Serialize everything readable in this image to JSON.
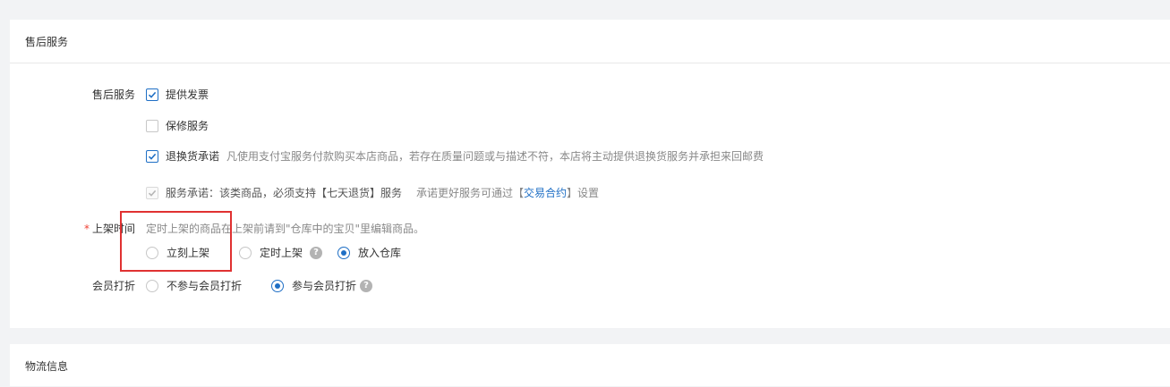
{
  "after_sales_section": {
    "title": "售后服务",
    "service_label": "售后服务",
    "options": [
      {
        "label": "提供发票",
        "checked": true
      },
      {
        "label": "保修服务",
        "checked": false
      },
      {
        "label": "退换货承诺",
        "checked": true,
        "desc": "凡使用支付宝服务付款购买本店商品，若存在质量问题或与描述不符，本店将主动提供退换货服务并承担来回邮费"
      }
    ],
    "promise": {
      "label": "服务承诺：该类商品，必须支持【七天退货】服务",
      "note_pre": "承诺更好服务可通过【",
      "link": "交易合约",
      "note_post": "】设置"
    },
    "listing_time": {
      "required_mark": "*",
      "label": "上架时间",
      "hint": "定时上架的商品在上架前请到\"仓库中的宝贝\"里编辑商品。",
      "options": [
        {
          "label": "立刻上架",
          "checked": false
        },
        {
          "label": "定时上架",
          "checked": false,
          "help": "?"
        },
        {
          "label": "放入仓库",
          "checked": true
        }
      ]
    },
    "member_discount": {
      "label": "会员打折",
      "options": [
        {
          "label": "不参与会员打折",
          "checked": false
        },
        {
          "label": "参与会员打折",
          "checked": true,
          "help": "?"
        }
      ]
    }
  },
  "logistics_section": {
    "title": "物流信息"
  },
  "colors": {
    "accent": "#1f6fc5",
    "highlight": "#e03131",
    "required": "#f04134"
  }
}
